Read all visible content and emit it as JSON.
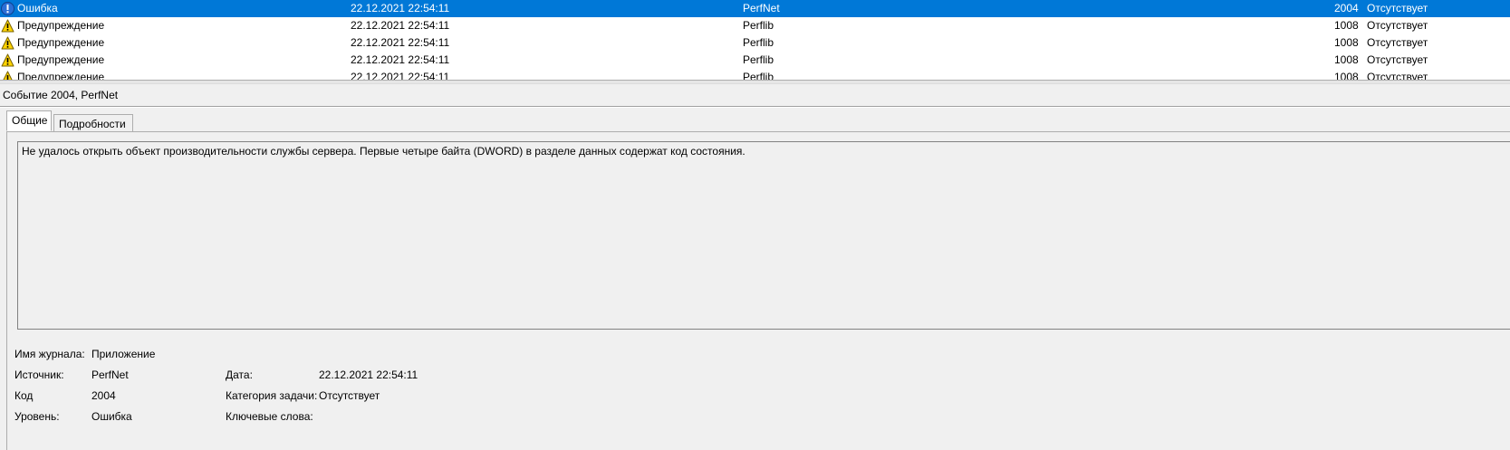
{
  "event_list": {
    "rows": [
      {
        "level": "Ошибка",
        "icon": "error-icon",
        "date": "22.12.2021 22:54:11",
        "source": "PerfNet",
        "id": "2004",
        "category": "Отсутствует",
        "selected": true
      },
      {
        "level": "Предупреждение",
        "icon": "warning-icon",
        "date": "22.12.2021 22:54:11",
        "source": "Perflib",
        "id": "1008",
        "category": "Отсутствует",
        "selected": false
      },
      {
        "level": "Предупреждение",
        "icon": "warning-icon",
        "date": "22.12.2021 22:54:11",
        "source": "Perflib",
        "id": "1008",
        "category": "Отсутствует",
        "selected": false
      },
      {
        "level": "Предупреждение",
        "icon": "warning-icon",
        "date": "22.12.2021 22:54:11",
        "source": "Perflib",
        "id": "1008",
        "category": "Отсутствует",
        "selected": false
      },
      {
        "level": "Предупреждение",
        "icon": "warning-icon",
        "date": "22.12.2021 22:54:11",
        "source": "Perflib",
        "id": "1008",
        "category": "Отсутствует",
        "selected": false
      }
    ]
  },
  "details": {
    "title": "Событие 2004, PerfNet",
    "tabs": [
      {
        "label": "Общие",
        "active": true
      },
      {
        "label": "Подробности",
        "active": false
      }
    ],
    "description": "Не удалось открыть объект производительности службы сервера. Первые четыре байта (DWORD) в разделе данных содержат код состояния.",
    "properties": {
      "log_name_label": "Имя журнала:",
      "log_name_value": "Приложение",
      "source_label": "Источник:",
      "source_value": "PerfNet",
      "date_label": "Дата:",
      "date_value": "22.12.2021 22:54:11",
      "code_label": "Код",
      "code_value": "2004",
      "task_category_label": "Категория задачи:",
      "task_category_value": "Отсутствует",
      "level_label": "Уровень:",
      "level_value": "Ошибка",
      "keywords_label": "Ключевые слова:",
      "keywords_value": ""
    }
  },
  "colors": {
    "selection": "#0078d7",
    "panel_background": "#f0f0f0",
    "error_icon": "#1c5fbf",
    "warning_icon": "#ffd400"
  }
}
